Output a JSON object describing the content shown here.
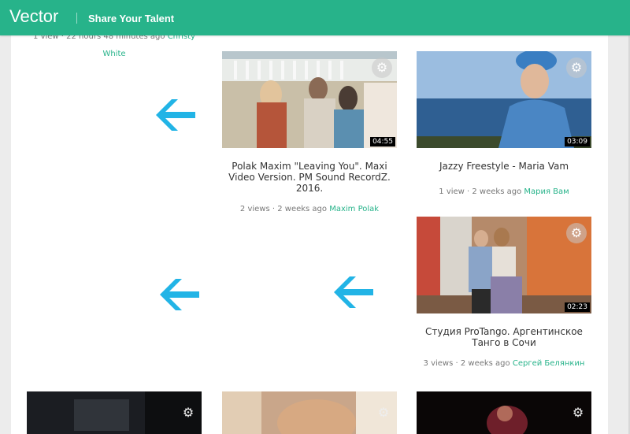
{
  "header": {
    "brand": "Vector",
    "tagline": "Share Your Talent"
  },
  "top_left_meta": {
    "stats": "1 view · 22 hours 48 minutes ago",
    "author_first": "Christy",
    "author_last": "White"
  },
  "videos": [
    {
      "title": "Polak Maxim \"Leaving You\". Maxi Video Version. PM Sound RecordZ. 2016.",
      "duration": "04:55",
      "stats": "2 views · 2 weeks ago",
      "author": "Maxim Polak"
    },
    {
      "title": "Jazzy Freestyle - Maria Vam",
      "duration": "03:09",
      "stats": "1 view · 2 weeks ago",
      "author": "Мария Вам"
    },
    {
      "title": "Студия ProTango. Аргентинское Танго в Сочи",
      "duration": "02:23",
      "stats": "3 views · 2 weeks ago",
      "author": "Сергей Белянкин"
    }
  ],
  "icons": {
    "gear": "gear-icon",
    "arrow": "arrow-left-icon"
  },
  "colors": {
    "brand": "#27b38a",
    "arrow": "#22b4e6",
    "author": "#27b38a"
  }
}
